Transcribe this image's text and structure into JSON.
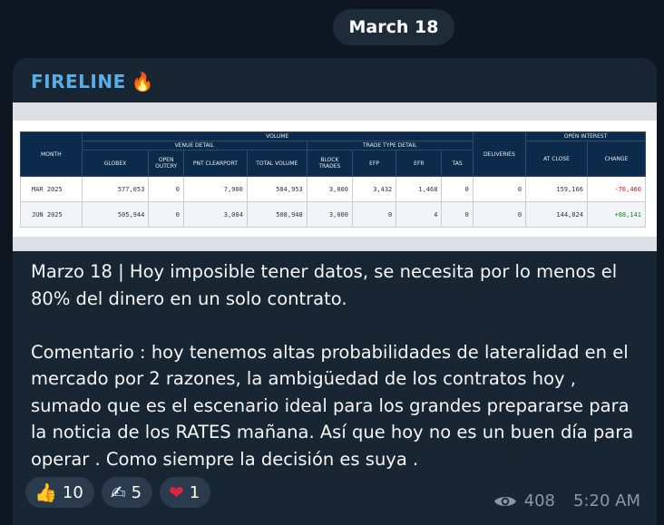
{
  "date_label": "March 18",
  "channel": {
    "name": "FIRELINE",
    "emoji_icon": "fire-icon"
  },
  "table": {
    "group_volume": "VOLUME",
    "group_open_interest": "OPEN INTEREST",
    "venue_detail": "VENUE DETAIL",
    "trade_type_detail": "TRADE TYPE DETAIL",
    "columns": {
      "month": "MONTH",
      "globex": "GLOBEX",
      "open_outcry": "OPEN OUTCRY",
      "pnt_clearport": "PNT CLEARPORT",
      "total_volume": "TOTAL VOLUME",
      "block_trades": "BLOCK TRADES",
      "efp": "EFP",
      "efr": "EFR",
      "tas": "TAS",
      "deliveries": "DELIVERIES",
      "at_close": "AT CLOSE",
      "change": "CHANGE"
    },
    "rows": [
      {
        "month": "MAR 2025",
        "globex": "577,053",
        "open_outcry": "0",
        "pnt_clearport": "7,900",
        "total_volume": "584,953",
        "block_trades": "3,000",
        "efp": "3,432",
        "efr": "1,468",
        "tas": "0",
        "deliveries": "0",
        "at_close": "159,166",
        "change": "-76,460"
      },
      {
        "month": "JUN 2025",
        "globex": "505,944",
        "open_outcry": "0",
        "pnt_clearport": "3,004",
        "total_volume": "508,948",
        "block_trades": "3,000",
        "efp": "0",
        "efr": "4",
        "tas": "0",
        "deliveries": "0",
        "at_close": "144,824",
        "change": "+88,141"
      }
    ]
  },
  "message": {
    "paragraph1": "Marzo 18 | Hoy imposible tener datos, se necesita por lo menos el 80% del dinero en un solo contrato.",
    "paragraph2": "Comentario : hoy tenemos altas probabilidades de lateralidad en el mercado por 2 razones, la ambigüedad de los contratos hoy , sumado que es el escenario ideal para los grandes prepararse para la noticia de los RATES mañana. Así que hoy no es un buen día para operar . Como siempre la decisión es suya ."
  },
  "reactions": [
    {
      "icon": "thumbs-up-icon",
      "emoji": "👍",
      "count": "10"
    },
    {
      "icon": "writing-hand-icon",
      "emoji": "✍",
      "count": "5"
    },
    {
      "icon": "heart-icon",
      "emoji": "❤",
      "count": "1"
    }
  ],
  "views": "408",
  "time": "5:20 AM",
  "colors": {
    "background": "#0e1621",
    "bubble": "#182533",
    "channel_name": "#5aaee8",
    "pill": "#1e2c3a"
  }
}
